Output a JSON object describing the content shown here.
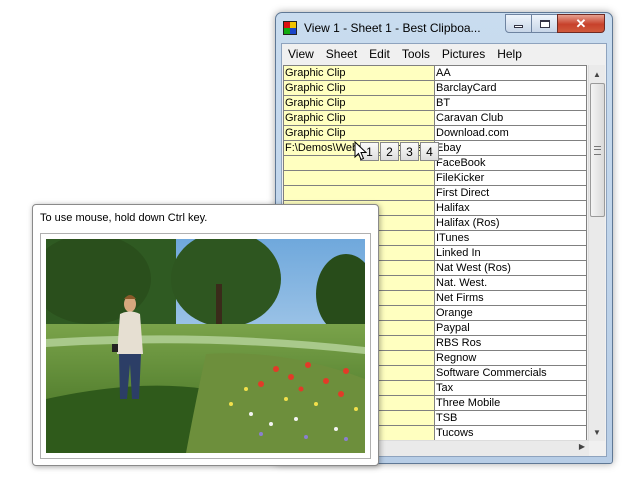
{
  "window": {
    "title": "View 1  -  Sheet 1  -  Best Clipboa...",
    "close_glyph": "✕"
  },
  "menu": [
    "View",
    "Sheet",
    "Edit",
    "Tools",
    "Pictures",
    "Help"
  ],
  "sheet": {
    "rows": [
      [
        "Graphic Clip",
        "AA"
      ],
      [
        "Graphic Clip",
        "BarclayCard"
      ],
      [
        "Graphic Clip",
        "BT"
      ],
      [
        "Graphic Clip",
        "Caravan Club"
      ],
      [
        "Graphic Clip",
        "Download.com"
      ],
      [
        "F:\\Demos\\Website_Tutorials\\",
        "Ebay"
      ],
      [
        "",
        "FaceBook"
      ],
      [
        "",
        "FileKicker"
      ],
      [
        "",
        "First Direct"
      ],
      [
        "",
        "Halifax"
      ],
      [
        "",
        "Halifax (Ros)"
      ],
      [
        "",
        "ITunes"
      ],
      [
        "",
        "Linked In"
      ],
      [
        "",
        "Nat West (Ros)"
      ],
      [
        "",
        "Nat. West."
      ],
      [
        "",
        "Net Firms"
      ],
      [
        "",
        "Orange"
      ],
      [
        "",
        "Paypal"
      ],
      [
        "",
        "RBS Ros"
      ],
      [
        "",
        "Regnow"
      ],
      [
        "",
        "Software Commercials"
      ],
      [
        "",
        "Tax"
      ],
      [
        "",
        "Three Mobile"
      ],
      [
        "",
        "TSB"
      ],
      [
        "",
        "Tucows"
      ]
    ]
  },
  "picture_buttons": [
    "1",
    "2",
    "3",
    "4"
  ],
  "picture_popup": {
    "hint": "To use mouse, hold down Ctrl key."
  },
  "colors": {
    "clip_column": "#ffffc0",
    "title_bar": "#c9dcef",
    "close_button": "#c7412b"
  },
  "icons": {
    "app": "four-color-grid-icon",
    "scroll_up": "triangle-up-icon",
    "scroll_down": "triangle-down-icon",
    "scroll_right": "triangle-right-icon",
    "cursor": "mouse-pointer-icon"
  }
}
